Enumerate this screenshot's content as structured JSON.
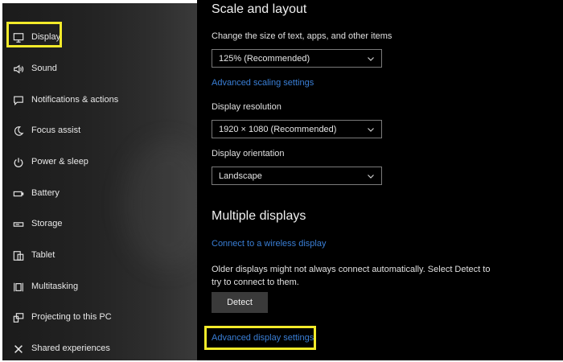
{
  "sidebar": {
    "items": [
      {
        "label": "Display",
        "icon": "monitor-icon"
      },
      {
        "label": "Sound",
        "icon": "speaker-icon"
      },
      {
        "label": "Notifications & actions",
        "icon": "message-icon"
      },
      {
        "label": "Focus assist",
        "icon": "moon-icon"
      },
      {
        "label": "Power & sleep",
        "icon": "power-icon"
      },
      {
        "label": "Battery",
        "icon": "battery-icon"
      },
      {
        "label": "Storage",
        "icon": "storage-icon"
      },
      {
        "label": "Tablet",
        "icon": "tablet-icon"
      },
      {
        "label": "Multitasking",
        "icon": "multitasking-icon"
      },
      {
        "label": "Projecting to this PC",
        "icon": "projecting-icon"
      },
      {
        "label": "Shared experiences",
        "icon": "shared-icon"
      }
    ]
  },
  "scale": {
    "title": "Scale and layout",
    "size_label": "Change the size of text, apps, and other items",
    "size_value": "125% (Recommended)",
    "advanced_scaling_link": "Advanced scaling settings",
    "resolution_label": "Display resolution",
    "resolution_value": "1920 × 1080 (Recommended)",
    "orientation_label": "Display orientation",
    "orientation_value": "Landscape"
  },
  "multiple": {
    "title": "Multiple displays",
    "wireless_link": "Connect to a wireless display",
    "detect_text": "Older displays might not always connect automatically. Select Detect to try to connect to them.",
    "detect_button": "Detect",
    "advanced_display_link": "Advanced display settings"
  },
  "colors": {
    "highlight": "#f2ea2a",
    "link": "#3a7fd6",
    "content_bg": "#000000"
  }
}
